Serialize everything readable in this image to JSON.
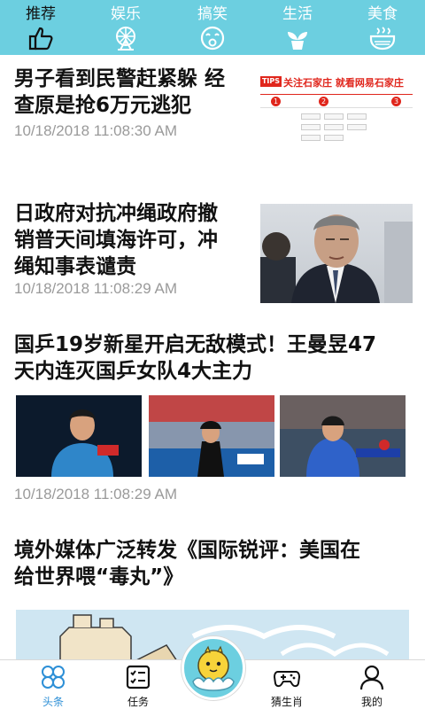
{
  "categories": [
    {
      "label": "推荐",
      "icon": "thumbs-up-icon",
      "active": true
    },
    {
      "label": "娱乐",
      "icon": "ferris-wheel-icon",
      "active": false
    },
    {
      "label": "搞笑",
      "icon": "laughing-face-icon",
      "active": false
    },
    {
      "label": "生活",
      "icon": "plant-icon",
      "active": false
    },
    {
      "label": "美食",
      "icon": "bowl-icon",
      "active": false
    }
  ],
  "articles": [
    {
      "title_lines": [
        "男子看到民警赶紧躲 经",
        "查原是抢6万元逃犯"
      ],
      "time": "10/18/2018 11:08:30 AM",
      "thumb": {
        "tips": "TIPS",
        "headline": "关注石家庄 就看网易石家庄"
      }
    },
    {
      "title_lines": [
        "日政府对抗冲绳政府撤",
        "销普天间填海许可，冲",
        "绳知事表谴责"
      ],
      "time": "10/18/2018 11:08:29 AM"
    },
    {
      "title_lines": [
        "国乒19岁新星开启无敌模式！王曼昱47",
        "天内连灭国乒女队4大主力"
      ],
      "time": "10/18/2018 11:08:29 AM"
    },
    {
      "title_lines": [
        "境外媒体广泛转发《国际锐评：美国在",
        "给世界喂“毒丸”》"
      ]
    }
  ],
  "bottom_nav": [
    {
      "label": "头条",
      "icon": "headlines-icon",
      "active": true
    },
    {
      "label": "任务",
      "icon": "task-list-icon",
      "active": false
    },
    {
      "label": "",
      "icon": "mascot-icon",
      "active": false
    },
    {
      "label": "猜生肖",
      "icon": "gamepad-icon",
      "active": false
    },
    {
      "label": "我的",
      "icon": "user-icon",
      "active": false
    }
  ],
  "colors": {
    "accent": "#6ccfe0",
    "active_nav": "#2d8fd6",
    "time": "#9a9a9a",
    "ad_red": "#e0261c"
  }
}
